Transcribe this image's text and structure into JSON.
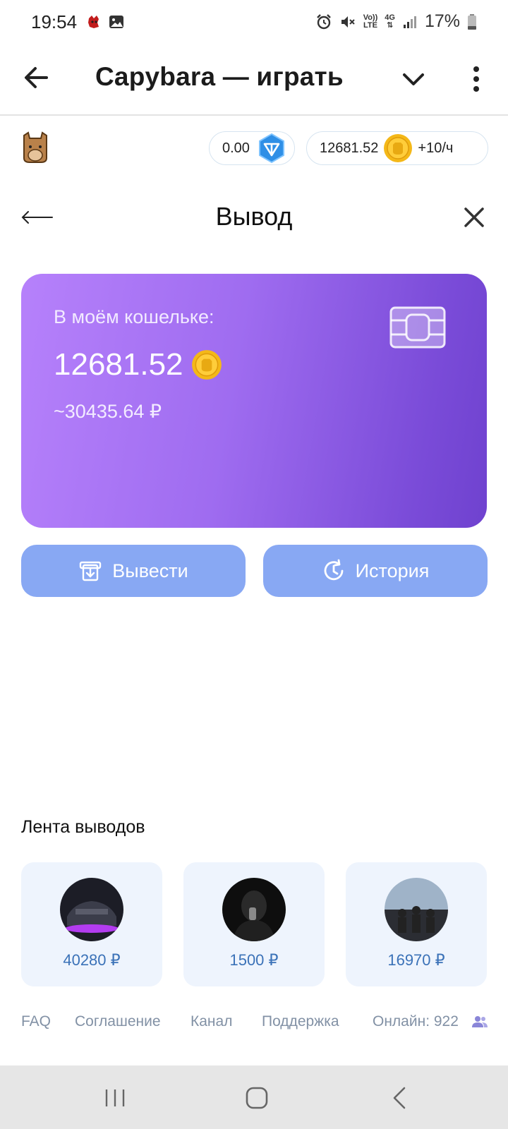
{
  "status_bar": {
    "time": "19:54",
    "battery": "17%",
    "volte_line1": "Vo))",
    "volte_line2": "LTE",
    "network": "4G"
  },
  "title_bar": {
    "title": "Capybara — играть",
    "icons": [
      "arrow-left-icon",
      "chevron-down-icon",
      "more-vert-icon"
    ]
  },
  "header": {
    "ton_balance": "0.00",
    "coin_balance": "12681.52",
    "rate": "+10/ч"
  },
  "withdraw": {
    "title": "Вывод",
    "card": {
      "label": "В моём кошельке:",
      "amount": "12681.52",
      "rub": "~30435.64 ₽"
    },
    "buttons": {
      "withdraw": "Вывести",
      "history": "История"
    }
  },
  "feed": {
    "title": "Лента выводов",
    "items": [
      {
        "amount": "40280 ₽"
      },
      {
        "amount": "1500 ₽"
      },
      {
        "amount": "16970 ₽"
      }
    ]
  },
  "footer": {
    "faq": "FAQ",
    "agreement": "Соглашение",
    "channel": "Канал",
    "support": "Поддержка",
    "online": "Онлайн: 922"
  },
  "colors": {
    "card_gradient_start": "#b681fb",
    "card_gradient_end": "#6f42cf",
    "button_bg": "#88a8f3",
    "feed_bg": "#eef4fd",
    "feed_amount": "#3b72b8",
    "footer_text": "#8291a5",
    "coin_gold": "#f4b818",
    "ton_blue": "#2f8fe6"
  }
}
